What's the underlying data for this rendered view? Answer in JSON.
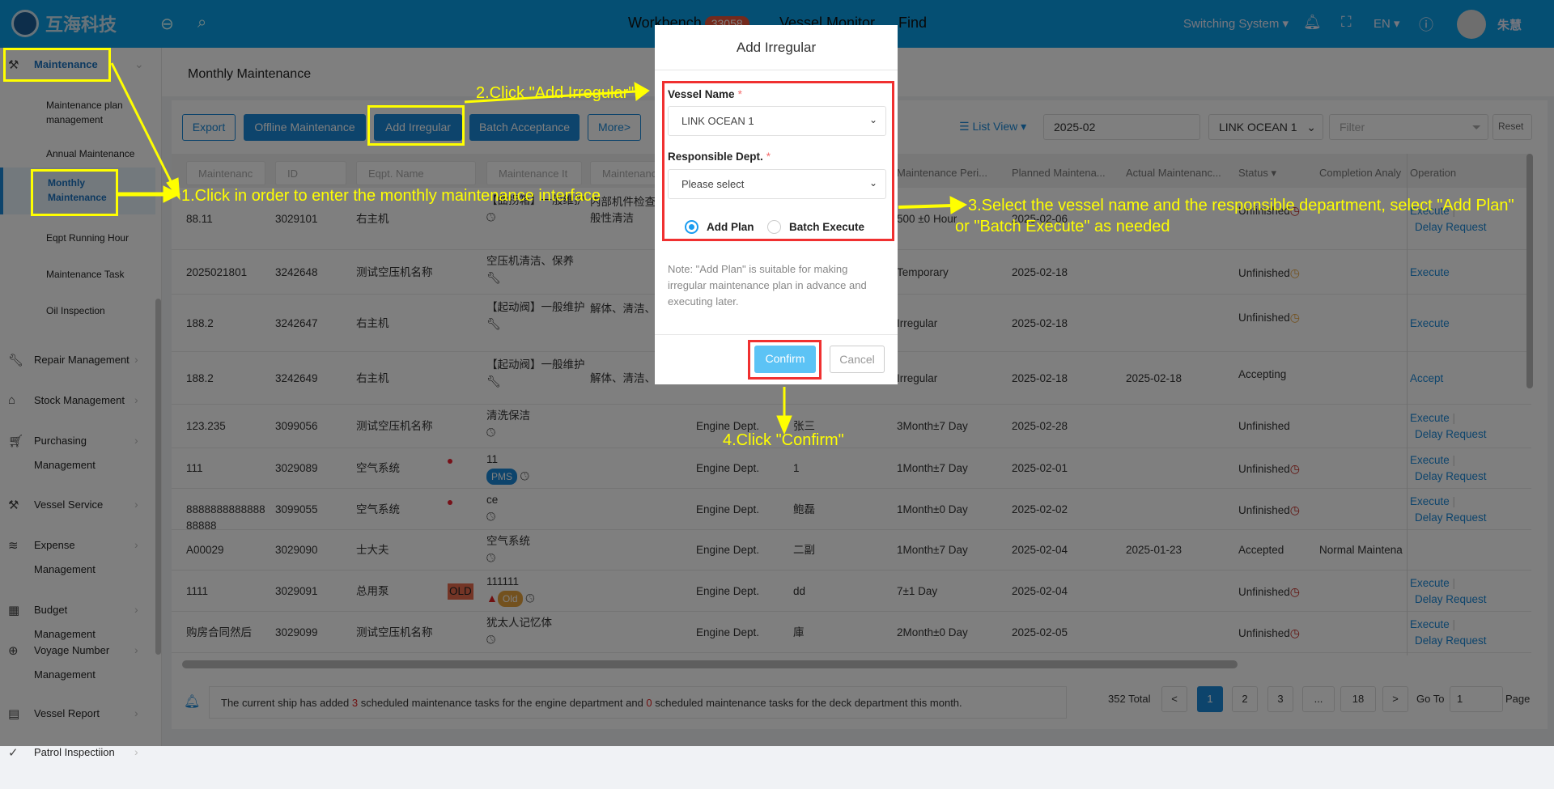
{
  "header": {
    "logo_text": "互海科技",
    "nav": [
      {
        "label": "Workbench",
        "badge": "33058"
      },
      {
        "label": "Vessel Monitor"
      },
      {
        "label": "Find"
      }
    ],
    "switching_system": "Switching System ▾",
    "language": "EN ▾",
    "user_name": "朱慧",
    "icons": [
      "back-icon",
      "search-icon",
      "bell-icon",
      "fullscreen-icon",
      "help-icon"
    ],
    "color": "#0a9ee6"
  },
  "sidebar": {
    "group": {
      "label": "Maintenance",
      "icon": "hammer-icon"
    },
    "subitems": [
      {
        "label": "Maintenance plan management"
      },
      {
        "label": "Annual Maintenance"
      },
      {
        "label": "Monthly Maintenance",
        "active": true
      },
      {
        "label": "Eqpt Running Hour"
      },
      {
        "label": "Maintenance Task"
      },
      {
        "label": "Oil Inspection"
      }
    ],
    "items": [
      {
        "label": "Repair Management",
        "icon": "wrench-icon"
      },
      {
        "label": "Stock Management",
        "icon": "home-icon"
      },
      {
        "label": "Purchasing Management",
        "icon": "cart-icon"
      },
      {
        "label": "Vessel Service",
        "icon": "paint-roller-icon"
      },
      {
        "label": "Expense Management",
        "icon": "database-icon"
      },
      {
        "label": "Budget Management",
        "icon": "calculator-icon"
      },
      {
        "label": "Voyage Number Management",
        "icon": "globe-icon"
      },
      {
        "label": "Vessel Report",
        "icon": "calendar-icon"
      },
      {
        "label": "Patrol Inspectiion",
        "icon": "check-circle-icon"
      }
    ]
  },
  "page": {
    "title": "Monthly Maintenance"
  },
  "toolbar": {
    "export": "Export",
    "offline": "Offline Maintenance",
    "add_irregular": "Add Irregular",
    "batch_acceptance": "Batch Acceptance",
    "more": "More>",
    "list_view": "List View ▾",
    "month": "2025-02",
    "vessel": "LINK OCEAN 1",
    "filter_placeholder": "Filter",
    "reset": "Reset"
  },
  "table": {
    "filters": [
      "Maintenanc",
      "ID",
      "Eqpt. Name",
      "Maintenance It",
      "Maintenanc"
    ],
    "headers": [
      "Maintenance Peri...",
      "Planned Maintena...",
      "Actual Maintenanc...",
      "Status ▾",
      "Completion Analy",
      "Operation"
    ],
    "rows": [
      {
        "no": "88.11",
        "id": "3029101",
        "eqpt": "右主机",
        "flag": "",
        "item": "【曲拐箱】一般维护",
        "item_icon": "clock",
        "content": "内部机件检查、一般性清洁",
        "dept": "",
        "person": "",
        "period": "500 ±0 Hour",
        "planned": "2025-02-06",
        "actual": "",
        "status": "Unfinished",
        "status_icon": "overdue",
        "completion": "",
        "ops": [
          "Execute",
          "Delay Request"
        ]
      },
      {
        "no": "2025021801",
        "id": "3242648",
        "eqpt": "测试空压机名称",
        "flag": "",
        "item": "空压机清洁、保养",
        "item_icon": "wrench",
        "content": "",
        "dept": "",
        "person": "",
        "period": "Temporary",
        "planned": "2025-02-18",
        "actual": "",
        "status": "Unfinished",
        "status_icon": "pending",
        "completion": "",
        "ops": [
          "Execute"
        ]
      },
      {
        "no": "188.2",
        "id": "3242647",
        "eqpt": "右主机",
        "flag": "",
        "item": "【起动阀】一般维护",
        "item_icon": "wrench",
        "content": "解体、清洁、",
        "dept": "",
        "person": "",
        "period": "Irregular",
        "planned": "2025-02-18",
        "actual": "",
        "status": "Unfinished",
        "status_icon": "pending",
        "completion": "",
        "ops": [
          "Execute"
        ]
      },
      {
        "no": "188.2",
        "id": "3242649",
        "eqpt": "右主机",
        "flag": "",
        "item": "【起动阀】一般维护",
        "item_icon": "wrench",
        "content": "解体、清洁、",
        "dept": "",
        "person": "",
        "period": "Irregular",
        "planned": "2025-02-18",
        "actual": "2025-02-18",
        "status": "Accepting",
        "status_icon": "",
        "completion": "",
        "ops": [
          "Accept"
        ]
      },
      {
        "no": "123.235",
        "id": "3099056",
        "eqpt": "测试空压机名称",
        "flag": "",
        "item": "清洗保洁",
        "item_icon": "clock",
        "content": "",
        "dept": "Engine Dept.",
        "person": "张三",
        "period": "3Month±7 Day",
        "planned": "2025-02-28",
        "actual": "",
        "status": "Unfinished",
        "status_icon": "",
        "completion": "",
        "ops": [
          "Execute",
          "Delay Request"
        ]
      },
      {
        "no": "111",
        "id": "3029089",
        "eqpt": "空气系统",
        "flag": "dot",
        "item": "11",
        "item_icon": "pms",
        "content": "",
        "dept": "Engine Dept.",
        "person": "1",
        "period": "1Month±7 Day",
        "planned": "2025-02-01",
        "actual": "",
        "status": "Unfinished",
        "status_icon": "overdue",
        "completion": "",
        "ops": [
          "Execute",
          "Delay Request"
        ]
      },
      {
        "no": "888888888888888888",
        "id": "3099055",
        "eqpt": "空气系统",
        "flag": "dot",
        "item": "ce",
        "item_icon": "clock",
        "content": "",
        "dept": "Engine Dept.",
        "person": "鲍磊",
        "period": "1Month±0 Day",
        "planned": "2025-02-02",
        "actual": "",
        "status": "Unfinished",
        "status_icon": "overdue",
        "completion": "",
        "ops": [
          "Execute",
          "Delay Request"
        ]
      },
      {
        "no": "A00029",
        "id": "3029090",
        "eqpt": "士大夫",
        "flag": "",
        "item": "空气系统",
        "item_icon": "clock",
        "content": "",
        "dept": "Engine Dept.",
        "person": "二副",
        "period": "1Month±7 Day",
        "planned": "2025-02-04",
        "actual": "2025-01-23",
        "status": "Accepted",
        "status_icon": "",
        "completion": "Normal Maintena",
        "ops": []
      },
      {
        "no": "1111",
        "id": "3029091",
        "eqpt": "总用泵",
        "flag": "OLD",
        "item": "111111",
        "item_icon": "old",
        "content": "",
        "dept": "Engine Dept.",
        "person": "dd",
        "period": "7±1 Day",
        "planned": "2025-02-04",
        "actual": "",
        "status": "Unfinished",
        "status_icon": "overdue",
        "completion": "",
        "ops": [
          "Execute",
          "Delay Request"
        ]
      },
      {
        "no": "购房合同然后",
        "id": "3029099",
        "eqpt": "测试空压机名称",
        "flag": "",
        "item": "犹太人记忆体",
        "item_icon": "clock",
        "content": "",
        "dept": "Engine Dept.",
        "person": "庫",
        "period": "2Month±0 Day",
        "planned": "2025-02-05",
        "actual": "",
        "status": "Unfinished",
        "status_icon": "overdue",
        "completion": "",
        "ops": [
          "Execute",
          "Delay Request"
        ]
      }
    ],
    "pms_label": "PMS",
    "old_label": "Old"
  },
  "notice": {
    "pre": "The current ship has added ",
    "engine_count": "3",
    "mid": " scheduled maintenance tasks for the engine department and ",
    "deck_count": "0",
    "post": " scheduled maintenance tasks for the deck department this month."
  },
  "pagination": {
    "total": "352 Total",
    "prev": "<",
    "pages": [
      "1",
      "2",
      "3",
      "...",
      "18"
    ],
    "current": "1",
    "next": ">",
    "goto_label": "Go To",
    "goto_value": "1",
    "page_label": "Page"
  },
  "modal": {
    "title": "Add Irregular",
    "vessel_label": "Vessel Name",
    "vessel_value": "LINK OCEAN 1",
    "dept_label": "Responsible Dept.",
    "dept_placeholder": "Please select",
    "required_mark": "*",
    "radio_add_plan": "Add Plan",
    "radio_batch_execute": "Batch Execute",
    "selected": "Add Plan",
    "note": "Note: \"Add Plan\" is suitable for making irregular maintenance plan in advance and executing later.",
    "confirm": "Confirm",
    "cancel": "Cancel"
  },
  "annotations": {
    "step1": "1.Click in order to enter the monthly maintenance interface",
    "step2": "2.Click \"Add Irregular\"",
    "step3_line1": "3.Select the vessel name and the responsible department, select \"Add Plan\"",
    "step3_line2": "or \"Batch Execute\" as needed",
    "step4": "4.Click \"Confirm\"",
    "color": "#ffff00"
  }
}
